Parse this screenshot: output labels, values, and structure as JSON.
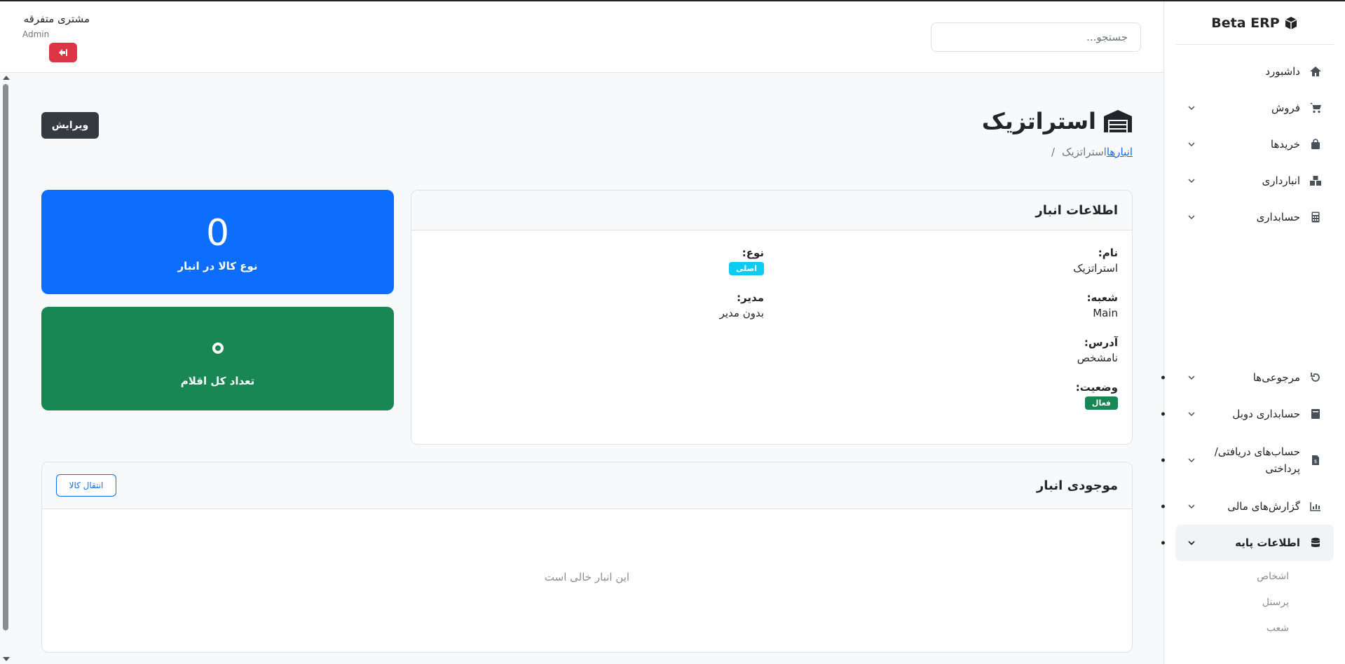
{
  "brand": {
    "name": "Beta ERP"
  },
  "header": {
    "search_placeholder": "جستجو...",
    "user_name": "مشتری متفرقه",
    "user_role": "Admin"
  },
  "sidebar": {
    "items": [
      {
        "label": "داشبورد",
        "icon": "home-icon"
      },
      {
        "label": "فروش",
        "icon": "cart-icon"
      },
      {
        "label": "خریدها",
        "icon": "bag-icon"
      },
      {
        "label": "انبارداری",
        "icon": "boxes-icon"
      },
      {
        "label": "حسابداری",
        "icon": "calculator-icon"
      },
      {
        "label": "مرجوعی‌ها",
        "icon": "undo-icon"
      },
      {
        "label": "حسابداری دوبل",
        "icon": "book-icon"
      },
      {
        "label": "حساب‌های دریافتی/پرداختی",
        "icon": "invoice-icon"
      },
      {
        "label": "گزارش‌های مالی",
        "icon": "chart-icon"
      },
      {
        "label": "اطلاعات پایه",
        "icon": "database-icon"
      }
    ],
    "subitems": [
      "اشخاص",
      "پرسنل",
      "شعب"
    ]
  },
  "page": {
    "title": "استراتزیک",
    "breadcrumb_link": "انبارها",
    "breadcrumb_current": "استراتزیک",
    "breadcrumb_sep": "/",
    "edit_label": "ویرایش"
  },
  "info": {
    "title": "اطلاعات انبار",
    "name_k": "نام:",
    "name_v": "استراتزیک",
    "branch_k": "شعبه:",
    "branch_v": "Main",
    "address_k": "آدرس:",
    "address_v": "نامشخص",
    "status_k": "وضعیت:",
    "status_v": "فعال",
    "type_k": "نوع:",
    "type_v": "اصلی",
    "manager_k": "مدیر:",
    "manager_v": "بدون مدیر"
  },
  "stats": {
    "types_value": "0",
    "types_label": "نوع کالا در انبار",
    "total_label": "تعداد کل اقلام"
  },
  "stock": {
    "title": "موجودی انبار",
    "transfer_label": "انتقال کالا",
    "empty_text": "این انبار خالی است"
  },
  "colors": {
    "primary": "#0d6efd",
    "success": "#198754",
    "danger": "#dc3545",
    "dark": "#343a40",
    "info": "#0dcaf0"
  }
}
